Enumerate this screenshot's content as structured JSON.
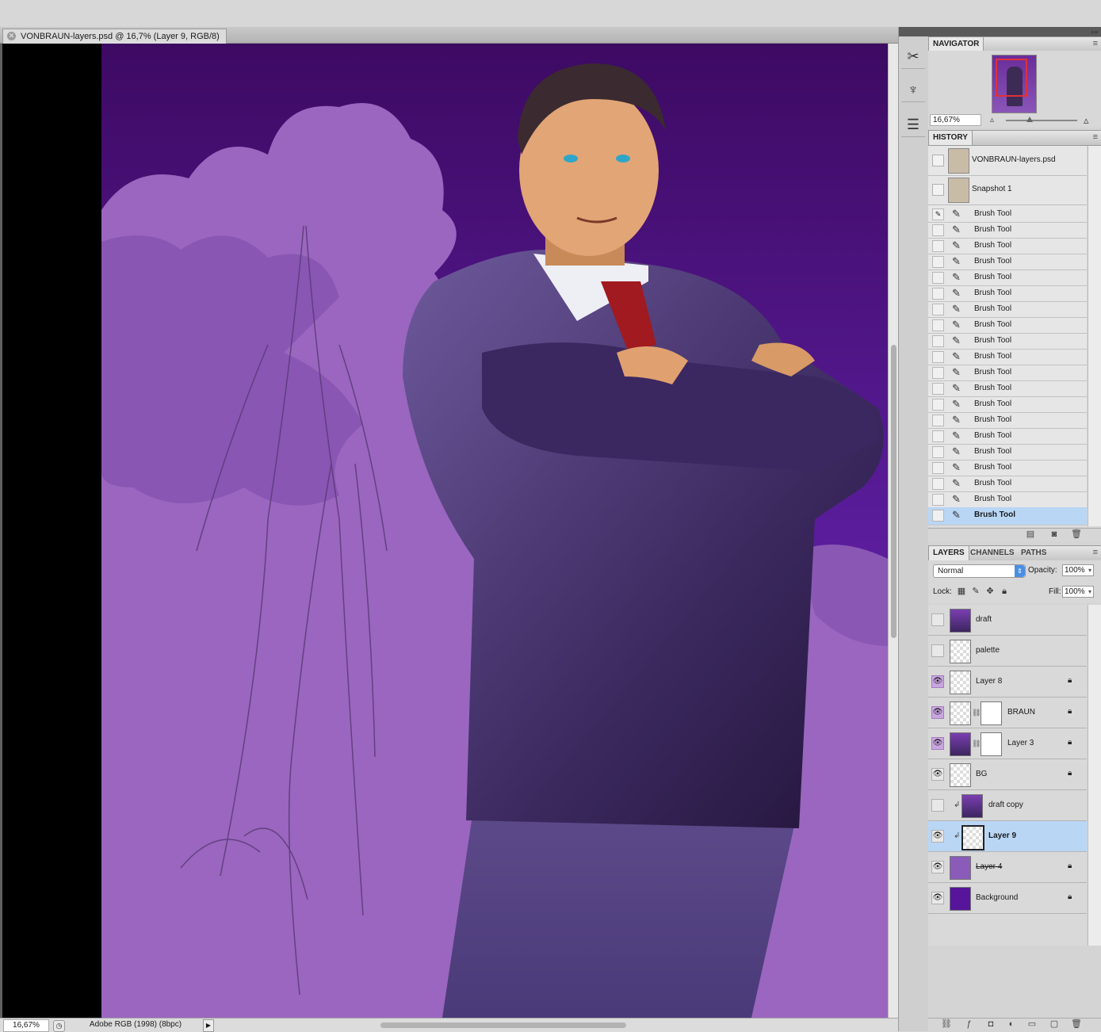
{
  "document": {
    "tab_title": "VONBRAUN-layers.psd @ 16,7% (Layer 9, RGB/8)",
    "status_zoom": "16,67%",
    "status_profile": "Adobe RGB (1998) (8bpc)"
  },
  "navigator": {
    "title": "NAVIGATOR",
    "zoom": "16,67%"
  },
  "history": {
    "title": "HISTORY",
    "snapshots": [
      "VONBRAUN-layers.psd",
      "Snapshot 1"
    ],
    "states": [
      "Brush Tool",
      "Brush Tool",
      "Brush Tool",
      "Brush Tool",
      "Brush Tool",
      "Brush Tool",
      "Brush Tool",
      "Brush Tool",
      "Brush Tool",
      "Brush Tool",
      "Brush Tool",
      "Brush Tool",
      "Brush Tool",
      "Brush Tool",
      "Brush Tool",
      "Brush Tool",
      "Brush Tool",
      "Brush Tool",
      "Brush Tool",
      "Brush Tool"
    ],
    "selected_state": "Brush Tool"
  },
  "layers_panel": {
    "tabs": [
      "LAYERS",
      "CHANNELS",
      "PATHS"
    ],
    "blend_mode": "Normal",
    "opacity_label": "Opacity:",
    "opacity": "100%",
    "lock_label": "Lock:",
    "fill_label": "Fill:",
    "fill": "100%",
    "layers": [
      {
        "name": "draft",
        "visible": false
      },
      {
        "name": "palette",
        "visible": false
      },
      {
        "name": "Layer 8",
        "visible": true,
        "locked": true
      },
      {
        "name": "BRAUN",
        "visible": true,
        "locked": true,
        "mask": true
      },
      {
        "name": "Layer 3",
        "visible": true,
        "locked": true,
        "mask": true
      },
      {
        "name": "BG",
        "visible": true,
        "locked": true
      },
      {
        "name": "draft copy",
        "visible": false,
        "clipped": true
      },
      {
        "name": "Layer 9",
        "visible": true,
        "clipped": true,
        "selected": true
      },
      {
        "name": "Layer 4",
        "visible": true,
        "locked": true
      },
      {
        "name": "Background",
        "visible": true,
        "locked": true
      }
    ]
  },
  "colors": {
    "sky_top": "#3d0a63",
    "sky_bottom": "#6b2fb0",
    "cloud": "#9a66bf",
    "selection": "#b9d6f5"
  }
}
